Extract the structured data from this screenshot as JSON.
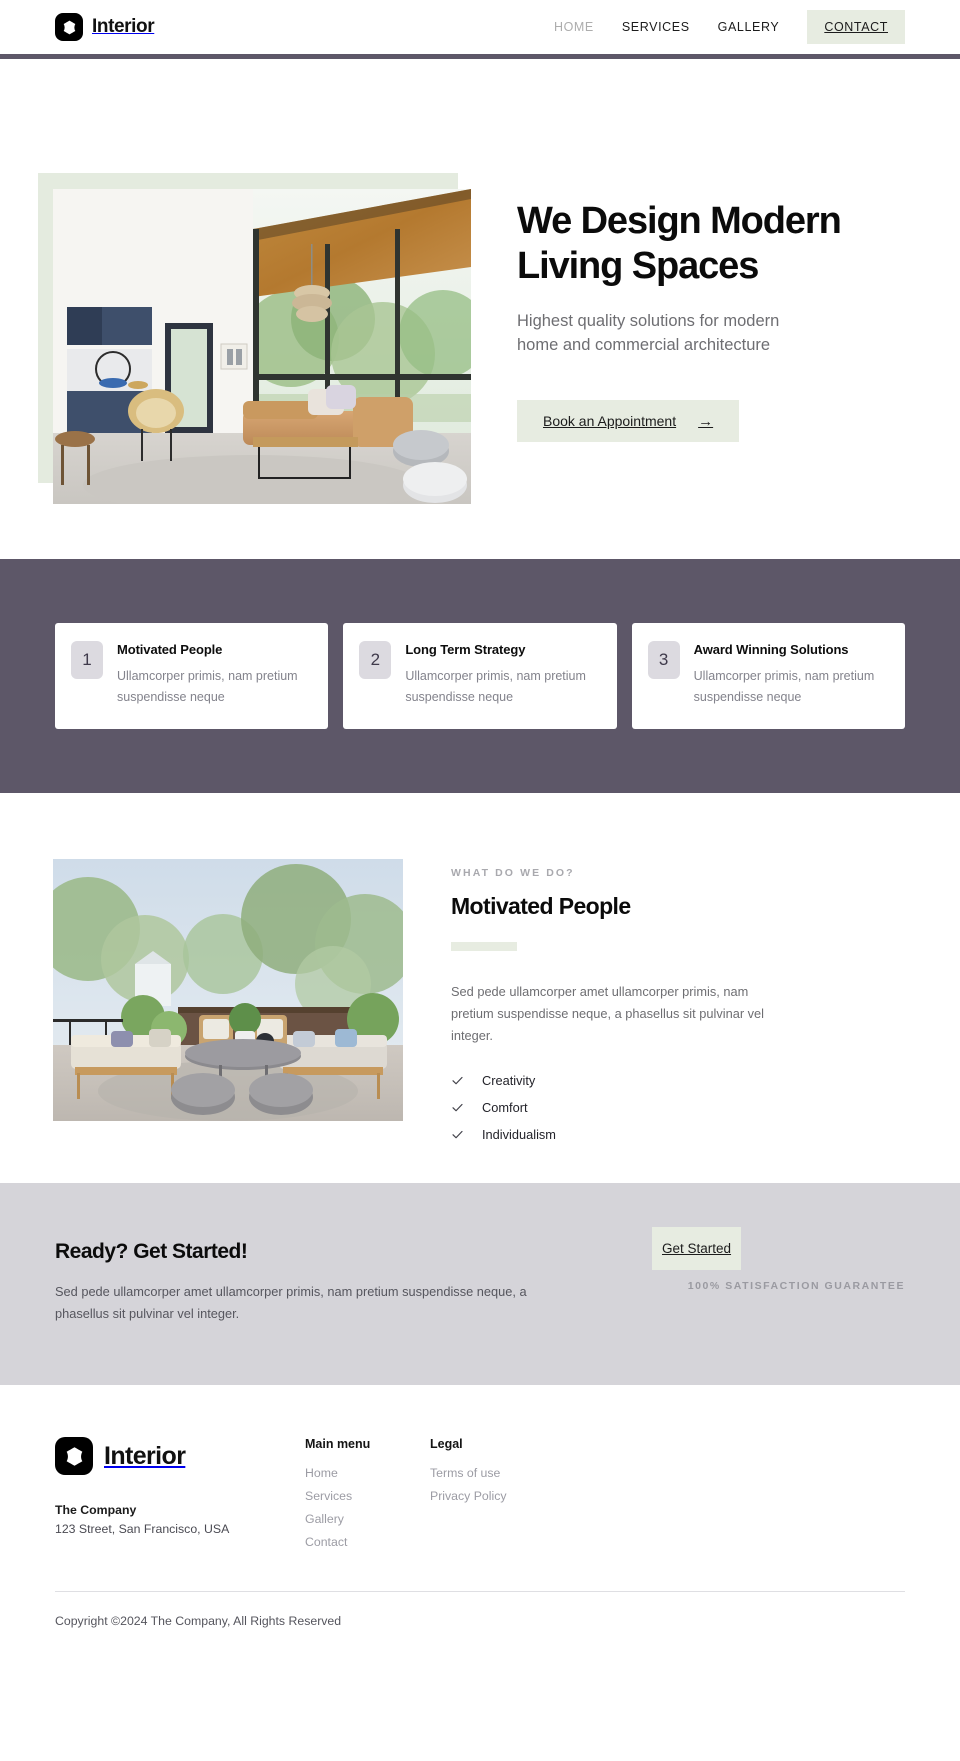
{
  "header": {
    "brand": "Interior",
    "logo_icon": "interior-diamond-logo",
    "nav": [
      {
        "label": "HOME",
        "state": "muted"
      },
      {
        "label": "SERVICES",
        "state": "default"
      },
      {
        "label": "GALLERY",
        "state": "default"
      }
    ],
    "cta": "CONTACT",
    "accent_rule_color": "#5d5768"
  },
  "hero": {
    "title": "We Design Modern Living Spaces",
    "subtitle": "Highest quality solutions for modern home and commercial architecture",
    "button": "Book an Appointment",
    "button_icon": "arrow-right-icon",
    "image_alt": "Modern living room with blue cabinetry, tan leather sectional and wood ceiling",
    "accent_block_color": "#e4ebdf",
    "button_color": "#e7ece1"
  },
  "features": {
    "background_color": "#5d5768",
    "cards": [
      {
        "number": "1",
        "title": "Motivated People",
        "description": "Ullamcorper primis, nam pretium suspendisse neque"
      },
      {
        "number": "2",
        "title": "Long Term Strategy",
        "description": "Ullamcorper primis, nam pretium suspendisse neque"
      },
      {
        "number": "3",
        "title": "Award Winning Solutions",
        "description": "Ullamcorper primis, nam pretium suspendisse neque"
      }
    ]
  },
  "about": {
    "eyebrow": "WHAT DO WE DO?",
    "title": "Motivated People",
    "description": "Sed pede ullamcorper amet ullamcorper primis, nam pretium suspendisse neque, a phasellus sit pulvinar vel integer.",
    "image_alt": "Outdoor terrace lounge with wicker furniture and trees",
    "checklist": [
      {
        "label": "Creativity",
        "icon": "check-icon"
      },
      {
        "label": "Comfort",
        "icon": "check-icon"
      },
      {
        "label": "Individualism",
        "icon": "check-icon"
      }
    ],
    "divider_color": "#e7ece1"
  },
  "cta": {
    "background_color": "#d5d4d9",
    "title": "Ready? Get Started!",
    "description": "Sed pede ullamcorper amet ullamcorper primis, nam pretium suspendisse neque, a phasellus sit pulvinar vel integer.",
    "button": "Get Started",
    "note": "100% SATISFACTION GUARANTEE"
  },
  "footer": {
    "brand": "Interior",
    "logo_icon": "interior-diamond-logo",
    "company": "The Company",
    "address": "123 Street, San Francisco, USA",
    "columns": [
      {
        "heading": "Main menu",
        "links": [
          "Home",
          "Services",
          "Gallery",
          "Contact"
        ]
      },
      {
        "heading": "Legal",
        "links": [
          "Terms of use",
          "Privacy Policy"
        ]
      }
    ],
    "copyright": "Copyright ©2024 The Company, All Rights Reserved"
  }
}
